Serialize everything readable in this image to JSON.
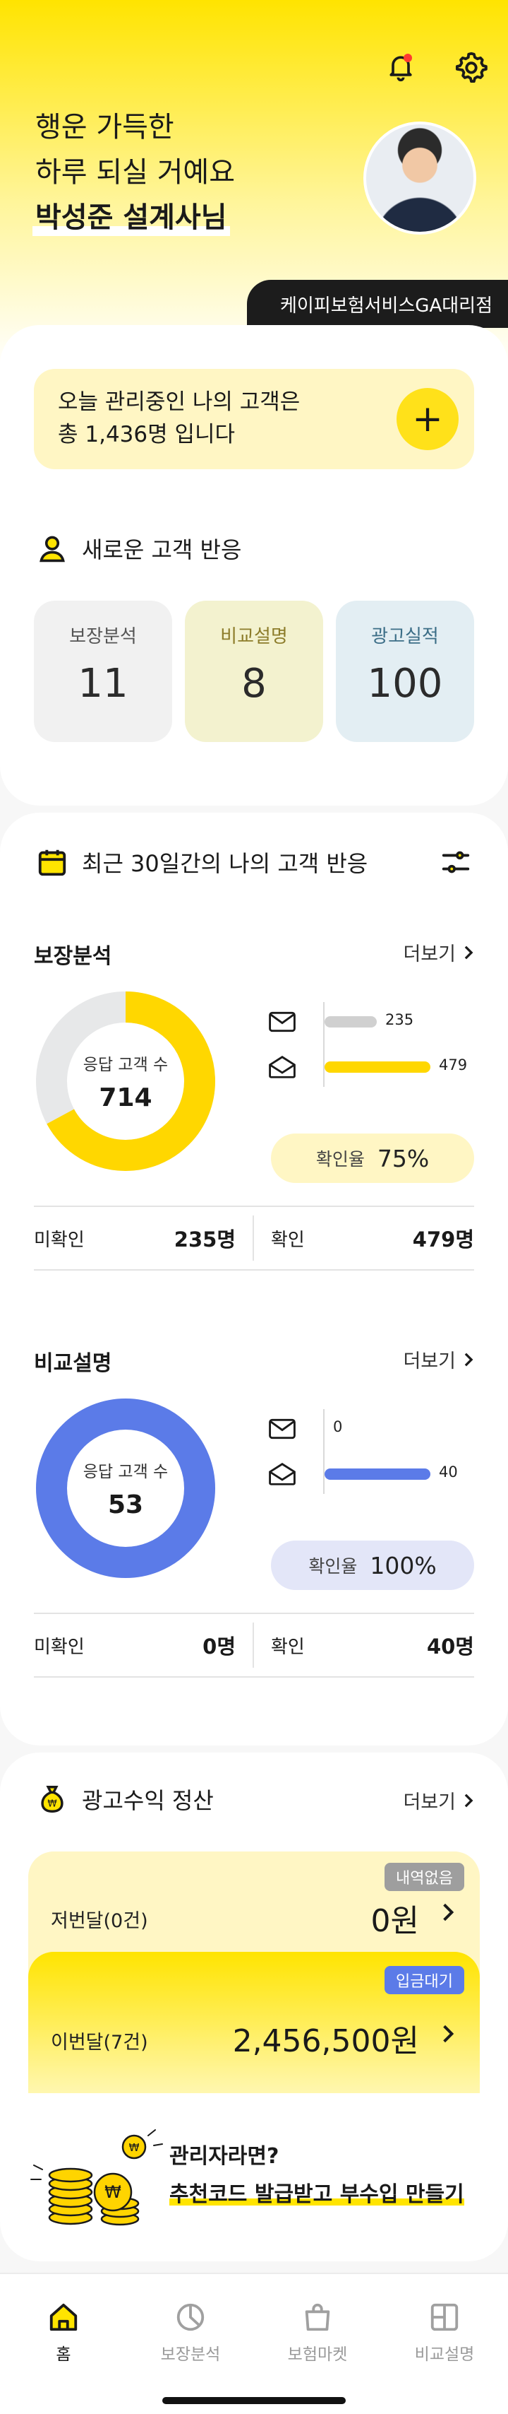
{
  "header": {
    "greeting_line1": "행운 가득한",
    "greeting_line2": "하루 되실 거예요",
    "name": "박성준 설계사님",
    "agency": "케이피보험서비스GA대리점",
    "icons": [
      "bell-icon",
      "gear-icon"
    ],
    "colors": {
      "accent": "#ffe400",
      "notification": "#ff3b30"
    }
  },
  "summary": {
    "line1": "오늘 관리중인 나의 고객은",
    "line2": "총 1,436명 입니다",
    "add_label": "+"
  },
  "new_reactions": {
    "title": "새로운 고객 반응",
    "stats": [
      {
        "label": "보장분석",
        "value": "11"
      },
      {
        "label": "비교설명",
        "value": "8"
      },
      {
        "label": "광고실적",
        "value": "100"
      }
    ]
  },
  "recent": {
    "title": "최근 30일간의 나의 고객 반응",
    "blocks": [
      {
        "title": "보장분석",
        "more": "더보기",
        "center_label": "응답 고객 수",
        "center_value": "714",
        "unread_count": 235,
        "read_count": 479,
        "unread_label": "235",
        "read_label": "479",
        "rate_label": "확인율",
        "rate_value": "75%",
        "unconfirmed_label": "미확인",
        "unconfirmed_value": "235명",
        "confirmed_label": "확인",
        "confirmed_value": "479명",
        "color": "#ffd700",
        "rate_bg": "#fff6c4"
      },
      {
        "title": "비교설명",
        "more": "더보기",
        "center_label": "응답 고객 수",
        "center_value": "53",
        "unread_count": 0,
        "read_count": 40,
        "unread_label": "0",
        "read_label": "40",
        "rate_label": "확인율",
        "rate_value": "100%",
        "unconfirmed_label": "미확인",
        "unconfirmed_value": "0명",
        "confirmed_label": "확인",
        "confirmed_value": "40명",
        "color": "#5b7be8",
        "rate_bg": "#e3e6f8"
      }
    ]
  },
  "ad_revenue": {
    "title": "광고수익 정산",
    "more": "더보기",
    "last_month": {
      "label": "저번달(0건)",
      "amount": "0원",
      "tag": "내역없음",
      "tag_color": "#9e9e9e"
    },
    "this_month": {
      "label": "이번달(7건)",
      "amount": "2,456,500원",
      "tag": "입금대기",
      "tag_color": "#5b7be8"
    }
  },
  "promo": {
    "line1": "관리자라면?",
    "line2": "추천코드 발급받고 부수입 만들기"
  },
  "nav": {
    "items": [
      {
        "label": "홈",
        "icon": "home-icon"
      },
      {
        "label": "보장분석",
        "icon": "pie-chart-icon"
      },
      {
        "label": "보험마켓",
        "icon": "shopping-bag-icon"
      },
      {
        "label": "비교설명",
        "icon": "grid-icon"
      }
    ],
    "active": "홈"
  }
}
